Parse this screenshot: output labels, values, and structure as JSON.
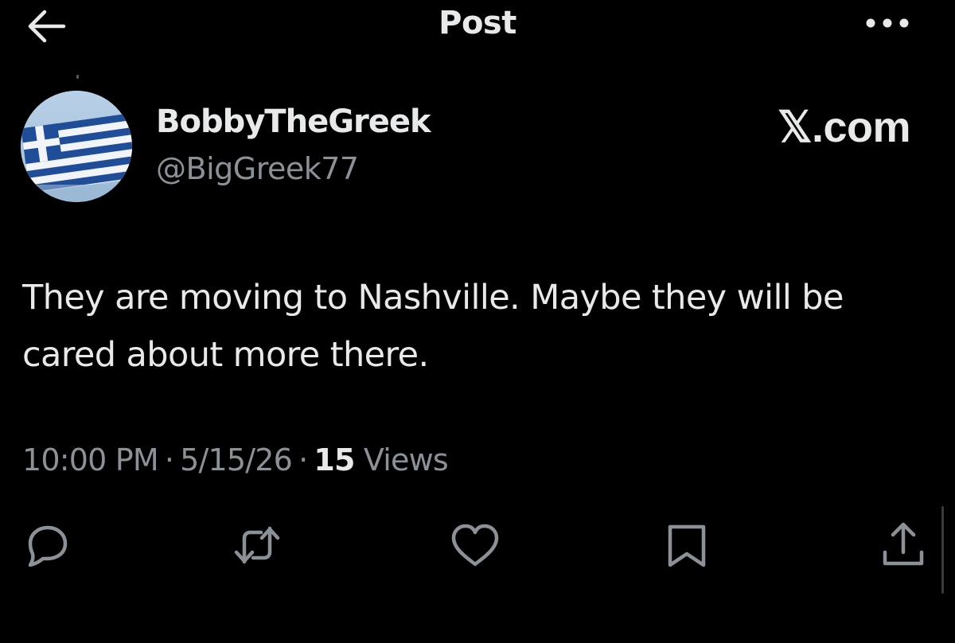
{
  "header": {
    "title": "Post",
    "back_icon": "arrow-left-icon",
    "more_icon": "more-horizontal-icon"
  },
  "author": {
    "display_name": "BobbyTheGreek",
    "handle": "@BigGreek77",
    "avatar": "greek-flag-avatar"
  },
  "watermark": "𝕏.com",
  "post": {
    "text": "They are moving to Nashville. Maybe they will be cared about more there."
  },
  "meta": {
    "time": "10:00 PM",
    "separator": "·",
    "date": "5/15/26",
    "views_count": "15",
    "views_label": "Views"
  },
  "actions": [
    {
      "name": "reply",
      "icon": "reply-icon"
    },
    {
      "name": "repost",
      "icon": "repost-icon"
    },
    {
      "name": "like",
      "icon": "heart-icon"
    },
    {
      "name": "bookmark",
      "icon": "bookmark-icon"
    },
    {
      "name": "share",
      "icon": "share-icon"
    }
  ],
  "colors": {
    "background": "#000000",
    "text_primary": "#e7e9ea",
    "text_secondary": "#8b9197",
    "flag_blue": "#1f4d98",
    "flag_white": "#ffffff"
  }
}
